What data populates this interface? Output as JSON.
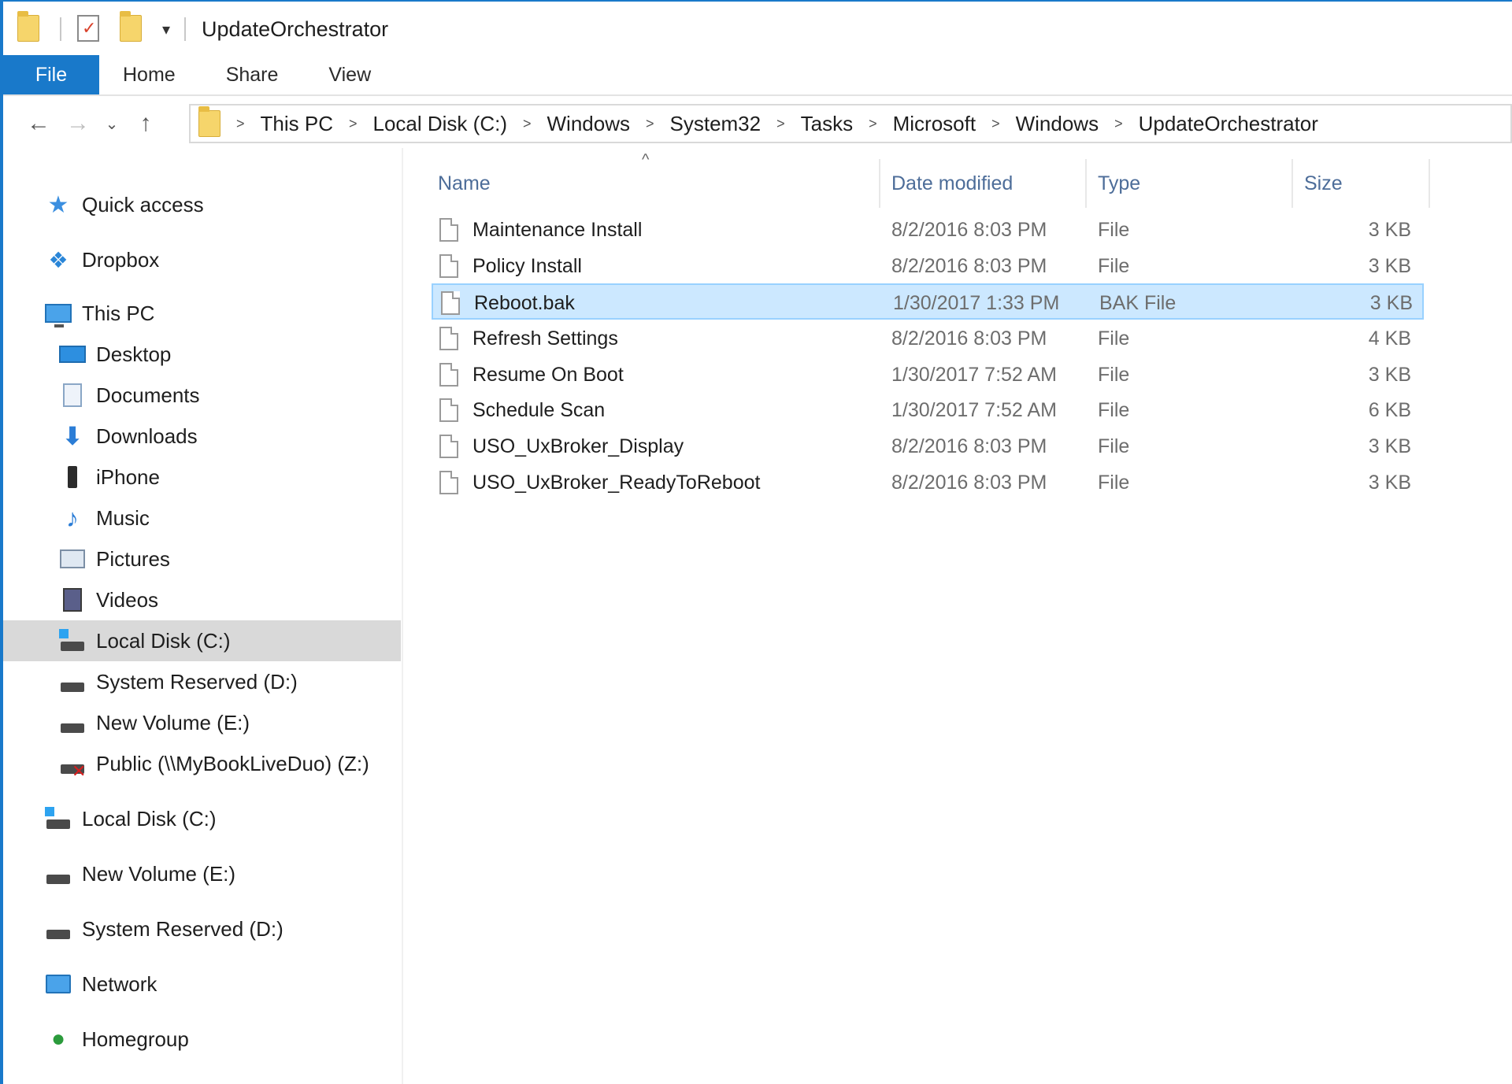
{
  "window": {
    "title": "UpdateOrchestrator"
  },
  "ribbon": {
    "tabs": [
      "File",
      "Home",
      "Share",
      "View"
    ]
  },
  "address": {
    "breadcrumbs": [
      "This PC",
      "Local Disk (C:)",
      "Windows",
      "System32",
      "Tasks",
      "Microsoft",
      "Windows",
      "UpdateOrchestrator"
    ]
  },
  "sidebar": {
    "items": [
      {
        "label": "Quick access",
        "icon": "star-icon"
      },
      {
        "label": "Dropbox",
        "icon": "dropbox-icon"
      },
      {
        "label": "This PC",
        "icon": "computer-icon"
      },
      {
        "label": "Desktop",
        "icon": "desktop-icon"
      },
      {
        "label": "Documents",
        "icon": "documents-icon"
      },
      {
        "label": "Downloads",
        "icon": "downloads-icon"
      },
      {
        "label": "iPhone",
        "icon": "phone-icon"
      },
      {
        "label": "Music",
        "icon": "music-icon"
      },
      {
        "label": "Pictures",
        "icon": "pictures-icon"
      },
      {
        "label": "Videos",
        "icon": "videos-icon"
      },
      {
        "label": "Local Disk (C:)",
        "icon": "windows-drive-icon",
        "selected": true
      },
      {
        "label": "System Reserved (D:)",
        "icon": "drive-icon"
      },
      {
        "label": "New Volume (E:)",
        "icon": "drive-icon"
      },
      {
        "label": "Public (\\\\MyBookLiveDuo) (Z:)",
        "icon": "disconnected-network-drive-icon"
      },
      {
        "label": "Local Disk (C:)",
        "icon": "windows-drive-icon"
      },
      {
        "label": "New Volume (E:)",
        "icon": "drive-icon"
      },
      {
        "label": "System Reserved (D:)",
        "icon": "drive-icon"
      },
      {
        "label": "Network",
        "icon": "network-icon"
      },
      {
        "label": "Homegroup",
        "icon": "homegroup-icon"
      }
    ]
  },
  "file_list": {
    "columns": {
      "name": "Name",
      "date": "Date modified",
      "type": "Type",
      "size": "Size"
    },
    "sort_indicator": "^",
    "rows": [
      {
        "name": "Maintenance Install",
        "date": "8/2/2016 8:03 PM",
        "type": "File",
        "size": "3 KB"
      },
      {
        "name": "Policy Install",
        "date": "8/2/2016 8:03 PM",
        "type": "File",
        "size": "3 KB"
      },
      {
        "name": "Reboot.bak",
        "date": "1/30/2017 1:33 PM",
        "type": "BAK File",
        "size": "3 KB",
        "selected": true
      },
      {
        "name": "Refresh Settings",
        "date": "8/2/2016 8:03 PM",
        "type": "File",
        "size": "4 KB"
      },
      {
        "name": "Resume On Boot",
        "date": "1/30/2017 7:52 AM",
        "type": "File",
        "size": "3 KB"
      },
      {
        "name": "Schedule Scan",
        "date": "1/30/2017 7:52 AM",
        "type": "File",
        "size": "6 KB"
      },
      {
        "name": "USO_UxBroker_Display",
        "date": "8/2/2016 8:03 PM",
        "type": "File",
        "size": "3 KB"
      },
      {
        "name": "USO_UxBroker_ReadyToReboot",
        "date": "8/2/2016 8:03 PM",
        "type": "File",
        "size": "3 KB"
      }
    ]
  },
  "colors": {
    "accent": "#1979ca",
    "selection": "#cce8ff",
    "header_text": "#4d6d99"
  }
}
